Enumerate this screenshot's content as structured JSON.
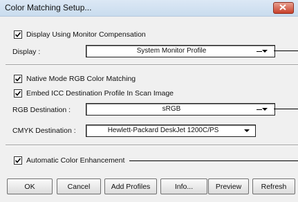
{
  "window": {
    "title": "Color Matching Setup..."
  },
  "section1": {
    "display_compensation": {
      "label": "Display Using Monitor Compensation",
      "checked": true
    },
    "display": {
      "label": "Display :",
      "value": "System Monitor Profile"
    }
  },
  "section2": {
    "native_mode": {
      "label": "Native Mode RGB Color Matching",
      "checked": true
    },
    "embed_icc": {
      "label": "Embed ICC Destination Profile In Scan Image",
      "checked": true
    },
    "rgb_destination": {
      "label": "RGB Destination :",
      "value": "sRGB"
    },
    "cmyk_destination": {
      "label": "CMYK Destination :",
      "value": "Hewlett-Packard DeskJet 1200C/PS"
    }
  },
  "section3": {
    "auto_enhancement": {
      "label": "Automatic Color Enhancement",
      "checked": true
    }
  },
  "buttons": {
    "ok": "OK",
    "cancel": "Cancel",
    "add_profiles": "Add Profiles",
    "info": "Info...",
    "preview": "Preview",
    "refresh": "Refresh"
  },
  "icons": {
    "close": "close-icon",
    "check": "check-icon",
    "dropdown": "chevron-down-icon"
  }
}
